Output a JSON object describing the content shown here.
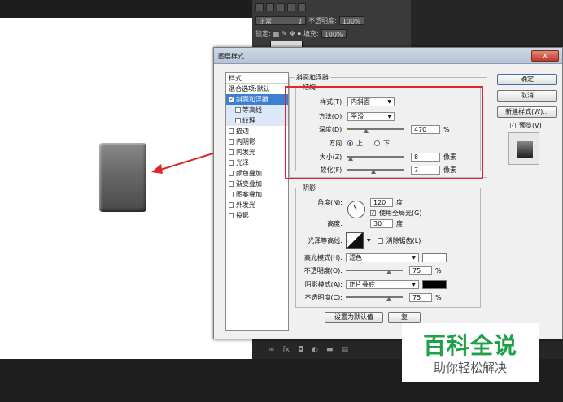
{
  "app": {
    "layers_panel": {
      "blend_mode": "正常",
      "opacity_label": "不透明度:",
      "opacity_value": "100%",
      "lock_label": "锁定:",
      "fill_label": "填充:",
      "fill_value": "100%"
    },
    "bottom_icons": [
      "∞",
      "fx",
      "◘",
      "◐",
      "▬",
      "▤"
    ]
  },
  "dialog": {
    "title": "图层样式",
    "close": "x",
    "style_list": {
      "header": "样式",
      "items": [
        {
          "label": "混合选项:默认",
          "checkbox": false,
          "selected": false,
          "sub": false,
          "checked": false
        },
        {
          "label": "斜面和浮雕",
          "checkbox": true,
          "selected": true,
          "sub": false,
          "checked": true
        },
        {
          "label": "等高线",
          "checkbox": true,
          "selected": false,
          "sub": true,
          "checked": false
        },
        {
          "label": "纹理",
          "checkbox": true,
          "selected": false,
          "sub": true,
          "checked": false
        },
        {
          "label": "描边",
          "checkbox": true,
          "selected": false,
          "sub": false,
          "checked": false
        },
        {
          "label": "内阴影",
          "checkbox": true,
          "selected": false,
          "sub": false,
          "checked": false
        },
        {
          "label": "内发光",
          "checkbox": true,
          "selected": false,
          "sub": false,
          "checked": false
        },
        {
          "label": "光泽",
          "checkbox": true,
          "selected": false,
          "sub": false,
          "checked": false
        },
        {
          "label": "颜色叠加",
          "checkbox": true,
          "selected": false,
          "sub": false,
          "checked": false
        },
        {
          "label": "渐变叠加",
          "checkbox": true,
          "selected": false,
          "sub": false,
          "checked": false
        },
        {
          "label": "图案叠加",
          "checkbox": true,
          "selected": false,
          "sub": false,
          "checked": false
        },
        {
          "label": "外发光",
          "checkbox": true,
          "selected": false,
          "sub": false,
          "checked": false
        },
        {
          "label": "投影",
          "checkbox": true,
          "selected": false,
          "sub": false,
          "checked": false
        }
      ]
    },
    "bevel": {
      "group_title": "斜面和浮雕",
      "structure_title": "结构",
      "style_label": "样式(T):",
      "style_value": "内斜面",
      "technique_label": "方法(Q):",
      "technique_value": "平滑",
      "depth_label": "深度(D):",
      "depth_value": "470",
      "depth_unit": "%",
      "depth_slider": 0.33,
      "direction_label": "方向:",
      "direction_up": "上",
      "direction_down": "下",
      "size_label": "大小(Z):",
      "size_value": "8",
      "size_unit": "像素",
      "size_slider": 0.06,
      "soften_label": "软化(F):",
      "soften_value": "7",
      "soften_unit": "像素",
      "soften_slider": 0.45
    },
    "shading": {
      "group_title": "阴影",
      "angle_label": "角度(N):",
      "angle_value": "120",
      "angle_unit": "度",
      "global_light_label": "使用全局光(G)",
      "altitude_label": "高度:",
      "altitude_value": "30",
      "altitude_unit": "度",
      "gloss_label": "光泽等高线:",
      "antialias_label": "消除锯齿(L)",
      "highlight_label": "高光模式(H):",
      "highlight_value": "滤色",
      "highlight_color": "#ffffff",
      "hl_opacity_label": "不透明度(O):",
      "hl_opacity_value": "75",
      "hl_opacity_unit": "%",
      "hl_opacity_slider": 0.75,
      "shadow_label": "阴影模式(A):",
      "shadow_value": "正片叠底",
      "shadow_color": "#000000",
      "sh_opacity_label": "不透明度(C):",
      "sh_opacity_value": "75",
      "sh_opacity_unit": "%",
      "sh_opacity_slider": 0.75
    },
    "buttons": {
      "default": "设置为默认值",
      "reset": "复",
      "ok": "确定",
      "cancel": "取消",
      "new_style": "新建样式(W)...",
      "preview": "预览(V)"
    }
  },
  "watermark": {
    "main": "百科全说",
    "sub": "助你轻松解决"
  },
  "colors": {
    "annotation_red": "#e0262a",
    "selection_blue": "#3d7fd1",
    "watermark_green": "#20a04a"
  }
}
